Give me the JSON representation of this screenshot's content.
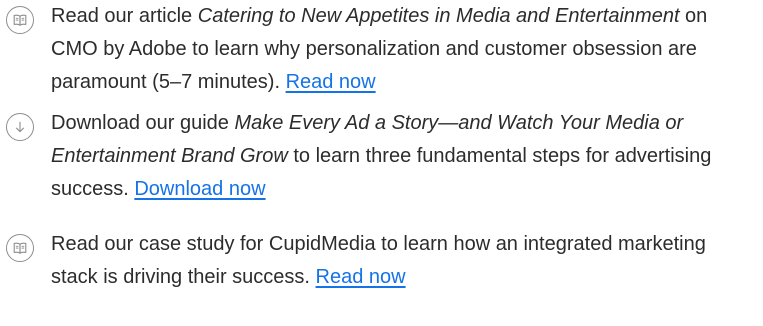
{
  "items": [
    {
      "icon": "book-icon",
      "lead": "Read our article ",
      "title": "Catering to New Appetites in Media and Entertainment",
      "rest": " on CMO by Adobe to learn why personalization and customer obsession are paramount (5–7 minutes). ",
      "link": "Read now"
    },
    {
      "icon": "download-arrow-icon",
      "lead": "Download our guide ",
      "title": "Make Every Ad a Story—and Watch Your Media or Entertainment Brand Grow",
      "rest": " to learn three fundamental steps for advertising success. ",
      "link": "Download now"
    },
    {
      "icon": "book-icon",
      "lead": "Read our case study for CupidMedia to learn how an integrated marketing stack is driving their success. ",
      "link": "Read now"
    }
  ],
  "colors": {
    "text": "#2c2c2c",
    "link": "#1473e6",
    "icon_stroke": "#8e8e8e"
  }
}
